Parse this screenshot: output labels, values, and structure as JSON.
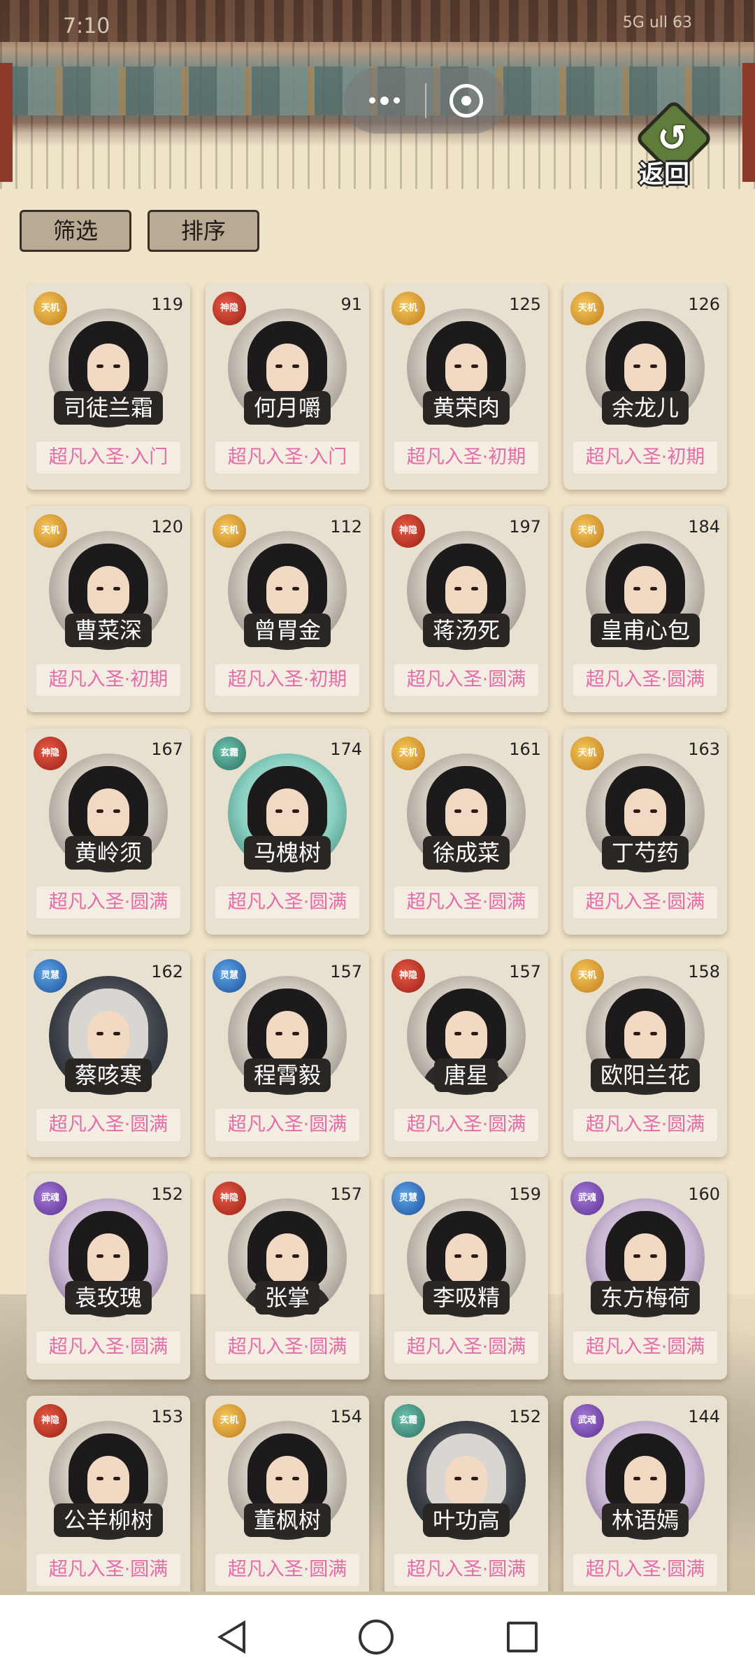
{
  "status_bar": {
    "time": "7:10",
    "right": "5G ull 63"
  },
  "capsule": {
    "more_icon": "more-dots-icon",
    "close_icon": "close-circle-icon"
  },
  "header": {
    "back_label": "返回"
  },
  "toolbar": {
    "filter_label": "筛选",
    "sort_label": "排序"
  },
  "cards": [
    {
      "name": "司徒兰霜",
      "level": "119",
      "realm": "超凡入圣·入门",
      "faction": "gold",
      "faction_text": "天机"
    },
    {
      "name": "何月嚼",
      "level": "91",
      "realm": "超凡入圣·入门",
      "faction": "red",
      "faction_text": "神隐"
    },
    {
      "name": "黄荣肉",
      "level": "125",
      "realm": "超凡入圣·初期",
      "faction": "gold",
      "faction_text": "天机"
    },
    {
      "name": "余龙儿",
      "level": "126",
      "realm": "超凡入圣·初期",
      "faction": "gold",
      "faction_text": "天机"
    },
    {
      "name": "曹菜深",
      "level": "120",
      "realm": "超凡入圣·初期",
      "faction": "gold",
      "faction_text": "天机"
    },
    {
      "name": "曾胃金",
      "level": "112",
      "realm": "超凡入圣·初期",
      "faction": "gold",
      "faction_text": "天机"
    },
    {
      "name": "蒋汤死",
      "level": "197",
      "realm": "超凡入圣·圆满",
      "faction": "red",
      "faction_text": "神隐"
    },
    {
      "name": "皇甫心包",
      "level": "184",
      "realm": "超凡入圣·圆满",
      "faction": "gold",
      "faction_text": "天机"
    },
    {
      "name": "黄岭须",
      "level": "167",
      "realm": "超凡入圣·圆满",
      "faction": "red",
      "faction_text": "神隐"
    },
    {
      "name": "马槐树",
      "level": "174",
      "realm": "超凡入圣·圆满",
      "faction": "teal",
      "faction_text": "玄霜"
    },
    {
      "name": "徐成菜",
      "level": "161",
      "realm": "超凡入圣·圆满",
      "faction": "gold",
      "faction_text": "天机"
    },
    {
      "name": "丁芍药",
      "level": "163",
      "realm": "超凡入圣·圆满",
      "faction": "gold",
      "faction_text": "天机"
    },
    {
      "name": "蔡咳寒",
      "level": "162",
      "realm": "超凡入圣·圆满",
      "faction": "blue",
      "faction_text": "灵慧"
    },
    {
      "name": "程霄毅",
      "level": "157",
      "realm": "超凡入圣·圆满",
      "faction": "blue",
      "faction_text": "灵慧"
    },
    {
      "name": "唐星",
      "level": "157",
      "realm": "超凡入圣·圆满",
      "faction": "red",
      "faction_text": "神隐"
    },
    {
      "name": "欧阳兰花",
      "level": "158",
      "realm": "超凡入圣·圆满",
      "faction": "gold",
      "faction_text": "天机"
    },
    {
      "name": "袁玫瑰",
      "level": "152",
      "realm": "超凡入圣·圆满",
      "faction": "purple",
      "faction_text": "武魂"
    },
    {
      "name": "张掌",
      "level": "157",
      "realm": "超凡入圣·圆满",
      "faction": "red",
      "faction_text": "神隐"
    },
    {
      "name": "李吸精",
      "level": "159",
      "realm": "超凡入圣·圆满",
      "faction": "blue",
      "faction_text": "灵慧"
    },
    {
      "name": "东方梅荷",
      "level": "160",
      "realm": "超凡入圣·圆满",
      "faction": "purple",
      "faction_text": "武魂"
    },
    {
      "name": "公羊柳树",
      "level": "153",
      "realm": "超凡入圣·圆满",
      "faction": "red",
      "faction_text": "神隐"
    },
    {
      "name": "董枫树",
      "level": "154",
      "realm": "超凡入圣·圆满",
      "faction": "gold",
      "faction_text": "天机"
    },
    {
      "name": "叶功高",
      "level": "152",
      "realm": "超凡入圣·圆满",
      "faction": "teal",
      "faction_text": "玄霜"
    },
    {
      "name": "林语嫣",
      "level": "144",
      "realm": "超凡入圣·圆满",
      "faction": "purple",
      "faction_text": "武魂"
    }
  ],
  "nav": {
    "back_icon": "nav-back-icon",
    "home_icon": "nav-home-icon",
    "recent_icon": "nav-recent-icon"
  }
}
